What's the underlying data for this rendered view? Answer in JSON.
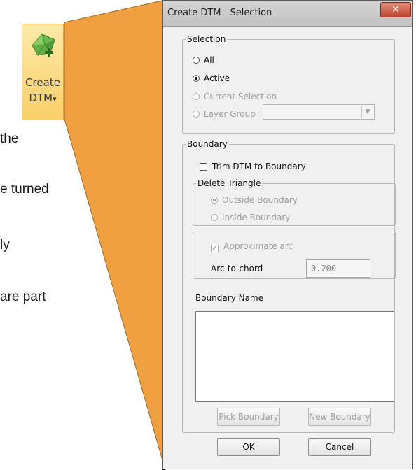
{
  "background_fragments": [
    "the",
    "e turned",
    "ly",
    "are part"
  ],
  "ribbon": {
    "line1": "Create",
    "line2": "DTM",
    "dropdown_glyph": "▾",
    "icon": "dtm-surface-icon"
  },
  "dialog": {
    "title": "Create DTM - Selection",
    "close_glyph": "✕",
    "selection": {
      "legend": "Selection",
      "options": [
        "All",
        "Active",
        "Current Selection",
        "Layer Group"
      ],
      "selected": "Active",
      "layer_group_value": ""
    },
    "boundary": {
      "legend": "Boundary",
      "trim_label": "Trim DTM to Boundary",
      "trim_checked": false,
      "delete_triangle": {
        "legend": "Delete Triangle",
        "options": [
          "Outside Boundary",
          "Inside Boundary"
        ],
        "selected": "Outside Boundary"
      },
      "approximate_arc_label": "Approximate arc",
      "approximate_arc_checked": true,
      "arc_to_chord_label": "Arc-to-chord",
      "arc_to_chord_value": "0.200",
      "boundary_name_label": "Boundary Name",
      "pick_boundary_label": "Pick Boundary",
      "new_boundary_label": "New Boundary"
    },
    "ok_label": "OK",
    "cancel_label": "Cancel"
  },
  "colors": {
    "callout": "#f0a040",
    "ribbon_bg": "#fbd97f",
    "close_button": "#c84a37",
    "dialog_bg": "#f0f0f0"
  }
}
